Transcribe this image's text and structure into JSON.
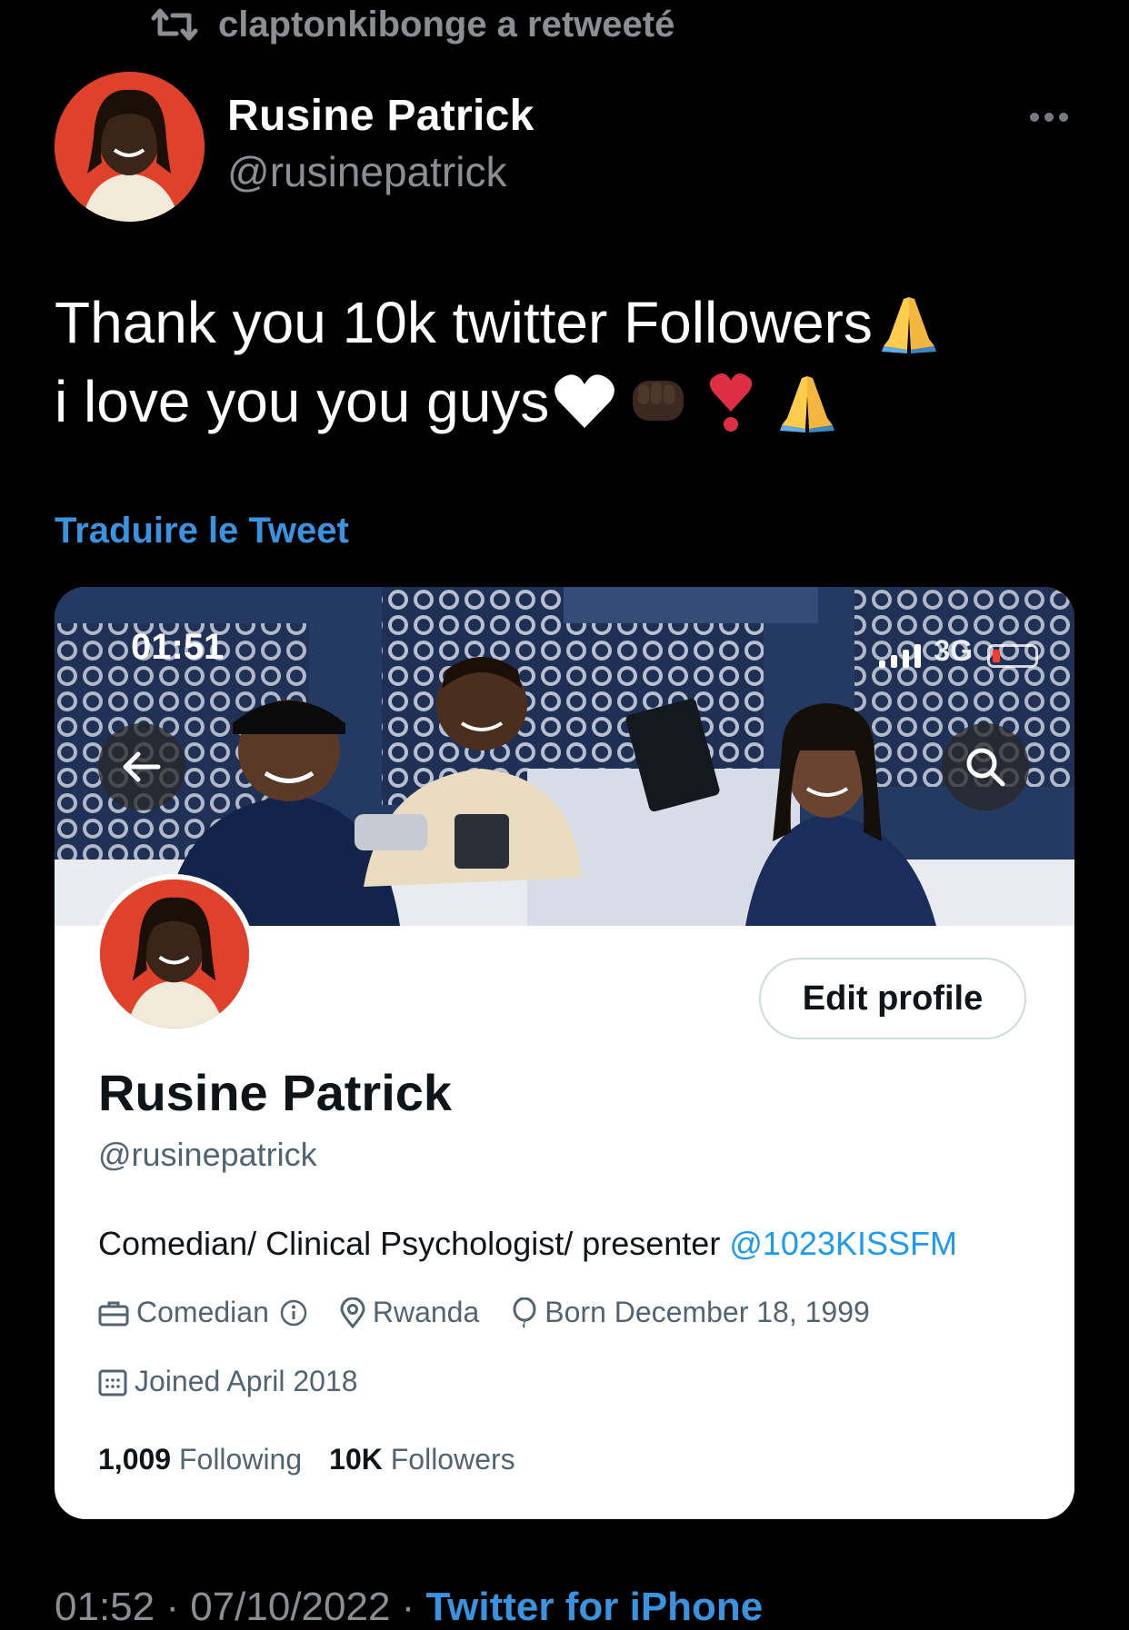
{
  "retweet": {
    "text": "claptonkibonge a retweeté",
    "icon": "retweet-icon"
  },
  "author": {
    "name": "Rusine Patrick",
    "handle": "@rusinepatrick",
    "more_icon": "more-horizontal-icon"
  },
  "tweet": {
    "line1": "Thank you 10k twitter Followers",
    "line2": "i love you you guys",
    "emoji_line1": [
      "folded-hands-emoji"
    ],
    "emoji_line2": [
      "white-heart-emoji",
      "fist-bump-emoji",
      "heart-exclamation-emoji",
      "folded-hands-emoji"
    ]
  },
  "translate_label": "Traduire le Tweet",
  "embedded_profile": {
    "status_time": "01:51",
    "network": "3G",
    "back_icon": "arrow-left-icon",
    "search_icon": "search-icon",
    "edit_button": "Edit profile",
    "name": "Rusine Patrick",
    "handle": "@rusinepatrick",
    "bio_text": "Comedian/ Clinical Psychologist/ presenter ",
    "bio_mention": "@1023KISSFM",
    "category": "Comedian",
    "location": "Rwanda",
    "birthday": "Born December 18, 1999",
    "joined": "Joined April 2018",
    "following_count": "1,009",
    "following_label": "Following",
    "followers_count": "10K",
    "followers_label": "Followers"
  },
  "footer": {
    "timestamp": "01:52 · 07/10/2022 · ",
    "source": "Twitter for iPhone"
  },
  "colors": {
    "background": "#000000",
    "link": "#3a93e0",
    "muted": "#8b8f94",
    "mention": "#1d9bf0",
    "avatar_bg": "#e0412a"
  }
}
